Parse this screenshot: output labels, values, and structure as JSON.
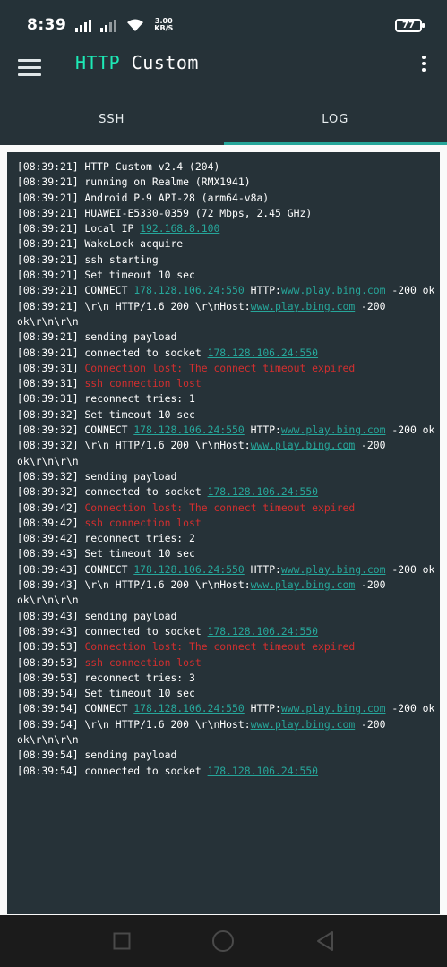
{
  "status_bar": {
    "time": "8:39",
    "speed_value": "3.00",
    "speed_unit": "KB/S",
    "battery": "77"
  },
  "app_bar": {
    "title_part1": "HTTP",
    "title_part2": "Custom",
    "menu_icon": "hamburger-icon",
    "overflow_icon": "more-vert-icon"
  },
  "tabs": [
    {
      "label": "SSH",
      "active": false
    },
    {
      "label": "LOG",
      "active": true
    }
  ],
  "colors": {
    "background": "#263238",
    "accent": "#26a69a",
    "title_accent": "#1de9b6",
    "error": "#d32f2f"
  },
  "log_lines": [
    [
      {
        "t": "[08:39:21] HTTP Custom v2.4 (204)"
      }
    ],
    [
      {
        "t": "[08:39:21] running on Realme (RMX1941)"
      }
    ],
    [
      {
        "t": "[08:39:21] Android P-9 API-28 (arm64-v8a)"
      }
    ],
    [
      {
        "t": "[08:39:21] HUAWEI-E5330-0359 (72 Mbps, 2.45 GHz)"
      }
    ],
    [
      {
        "t": "[08:39:21] Local IP "
      },
      {
        "t": "192.168.8.100",
        "c": "link"
      }
    ],
    [
      {
        "t": "[08:39:21] WakeLock acquire"
      }
    ],
    [
      {
        "t": "[08:39:21] ssh starting"
      }
    ],
    [
      {
        "t": "[08:39:21] Set timeout 10 sec"
      }
    ],
    [
      {
        "t": "[08:39:21] CONNECT "
      },
      {
        "t": "178.128.106.24:550",
        "c": "link"
      },
      {
        "t": " HTTP:"
      },
      {
        "t": "www.play.bing.com",
        "c": "link"
      },
      {
        "t": " -200 ok"
      }
    ],
    [
      {
        "t": "[08:39:21] \\r\\n HTTP/1.6 200 \\r\\nHost:"
      },
      {
        "t": "www.play.bing.com",
        "c": "link"
      },
      {
        "t": " -200"
      }
    ],
    [
      {
        "t": "ok\\r\\n\\r\\n"
      }
    ],
    [
      {
        "t": "[08:39:21] sending payload"
      }
    ],
    [
      {
        "t": "[08:39:21] connected to socket "
      },
      {
        "t": "178.128.106.24:550",
        "c": "link"
      }
    ],
    [
      {
        "t": "[08:39:31] "
      },
      {
        "t": "Connection lost: The connect timeout expired",
        "c": "err"
      }
    ],
    [
      {
        "t": "[08:39:31] "
      },
      {
        "t": "ssh connection lost",
        "c": "err"
      }
    ],
    [
      {
        "t": "[08:39:31] reconnect tries: 1"
      }
    ],
    [
      {
        "t": "[08:39:32] Set timeout 10 sec"
      }
    ],
    [
      {
        "t": "[08:39:32] CONNECT "
      },
      {
        "t": "178.128.106.24:550",
        "c": "link"
      },
      {
        "t": " HTTP:"
      },
      {
        "t": "www.play.bing.com",
        "c": "link"
      },
      {
        "t": " -200 ok"
      }
    ],
    [
      {
        "t": "[08:39:32] \\r\\n HTTP/1.6 200 \\r\\nHost:"
      },
      {
        "t": "www.play.bing.com",
        "c": "link"
      },
      {
        "t": " -200"
      }
    ],
    [
      {
        "t": "ok\\r\\n\\r\\n"
      }
    ],
    [
      {
        "t": "[08:39:32] sending payload"
      }
    ],
    [
      {
        "t": "[08:39:32] connected to socket "
      },
      {
        "t": "178.128.106.24:550",
        "c": "link"
      }
    ],
    [
      {
        "t": "[08:39:42] "
      },
      {
        "t": "Connection lost: The connect timeout expired",
        "c": "err"
      }
    ],
    [
      {
        "t": "[08:39:42] "
      },
      {
        "t": "ssh connection lost",
        "c": "err"
      }
    ],
    [
      {
        "t": "[08:39:42] reconnect tries: 2"
      }
    ],
    [
      {
        "t": "[08:39:43] Set timeout 10 sec"
      }
    ],
    [
      {
        "t": "[08:39:43] CONNECT "
      },
      {
        "t": "178.128.106.24:550",
        "c": "link"
      },
      {
        "t": " HTTP:"
      },
      {
        "t": "www.play.bing.com",
        "c": "link"
      },
      {
        "t": " -200 ok"
      }
    ],
    [
      {
        "t": "[08:39:43] \\r\\n HTTP/1.6 200 \\r\\nHost:"
      },
      {
        "t": "www.play.bing.com",
        "c": "link"
      },
      {
        "t": " -200"
      }
    ],
    [
      {
        "t": "ok\\r\\n\\r\\n"
      }
    ],
    [
      {
        "t": "[08:39:43] sending payload"
      }
    ],
    [
      {
        "t": "[08:39:43] connected to socket "
      },
      {
        "t": "178.128.106.24:550",
        "c": "link"
      }
    ],
    [
      {
        "t": "[08:39:53] "
      },
      {
        "t": "Connection lost: The connect timeout expired",
        "c": "err"
      }
    ],
    [
      {
        "t": "[08:39:53] "
      },
      {
        "t": "ssh connection lost",
        "c": "err"
      }
    ],
    [
      {
        "t": "[08:39:53] reconnect tries: 3"
      }
    ],
    [
      {
        "t": "[08:39:54] Set timeout 10 sec"
      }
    ],
    [
      {
        "t": "[08:39:54] CONNECT "
      },
      {
        "t": "178.128.106.24:550",
        "c": "link"
      },
      {
        "t": " HTTP:"
      },
      {
        "t": "www.play.bing.com",
        "c": "link"
      },
      {
        "t": " -200 ok"
      }
    ],
    [
      {
        "t": "[08:39:54] \\r\\n HTTP/1.6 200 \\r\\nHost:"
      },
      {
        "t": "www.play.bing.com",
        "c": "link"
      },
      {
        "t": " -200"
      }
    ],
    [
      {
        "t": "ok\\r\\n\\r\\n"
      }
    ],
    [
      {
        "t": "[08:39:54] sending payload"
      }
    ],
    [
      {
        "t": "[08:39:54] connected to socket "
      },
      {
        "t": "178.128.106.24:550",
        "c": "link"
      }
    ]
  ],
  "nav_bar": {
    "recents_icon": "square-recents-icon",
    "home_icon": "circle-home-icon",
    "back_icon": "triangle-back-icon"
  }
}
